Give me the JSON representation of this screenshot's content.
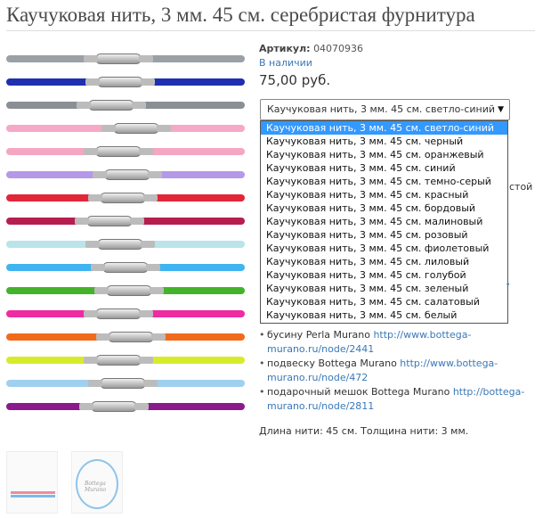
{
  "product": {
    "title": "Каучуковая нить, 3 мм. 45 см. серебристая фурнитура",
    "sku_label": "Артикул:",
    "sku_value": "04070936",
    "stock_status": "В наличии",
    "price": "75,00 руб."
  },
  "variant_select": {
    "selected_label": "Каучуковая нить, 3 мм. 45 см. светло-синий",
    "arrow_glyph": "▼",
    "options": [
      "Каучуковая нить, 3 мм. 45 см. светло-синий",
      "Каучуковая нить, 3 мм. 45 см. черный",
      "Каучуковая нить, 3 мм. 45 см. оранжевый",
      "Каучуковая нить, 3 мм. 45 см. синий",
      "Каучуковая нить, 3 мм. 45 см. темно-серый",
      "Каучуковая нить, 3 мм. 45 см. красный",
      "Каучуковая нить, 3 мм. 45 см. бордовый",
      "Каучуковая нить, 3 мм. 45 см. малиновый",
      "Каучуковая нить, 3 мм. 45 см. розовый",
      "Каучуковая нить, 3 мм. 45 см. фиолетовый",
      "Каучуковая нить, 3 мм. 45 см. лиловый",
      "Каучуковая нить, 3 мм. 45 см. голубой",
      "Каучуковая нить, 3 мм. 45 см. зеленый",
      "Каучуковая нить, 3 мм. 45 см. салатовый",
      "Каучуковая нить, 3 мм. 45 см. белый"
    ]
  },
  "background_fragments": {
    "partial_word": "стой",
    "partial_dot": "•"
  },
  "bullets": [
    {
      "text": "бусину Perla Murano ",
      "link": "http://www.bottega-murano.ru/node/2441"
    },
    {
      "text": "подвеску Bottega Murano ",
      "link": "http://www.bottega-murano.ru/node/472"
    },
    {
      "text": "подарочный мешок Bottega Murano ",
      "link": "http://bottega-murano.ru/node/2811"
    }
  ],
  "specs": "Длина нити: 45 см. Толщина нити: 3 мм.",
  "cord_colors": [
    "#9aa0a6",
    "#1f2fb0",
    "#8a8f96",
    "#f6a8c8",
    "#f4a6c2",
    "#b598e8",
    "#e2263a",
    "#b51e4e",
    "#b8e4ea",
    "#3fb4f0",
    "#43b32c",
    "#ee2ba0",
    "#f16a1c",
    "#d6ec2a",
    "#9fd0f0",
    "#8b1a8a"
  ],
  "thumbnails": {
    "logo_text": "Bottega Murano"
  }
}
